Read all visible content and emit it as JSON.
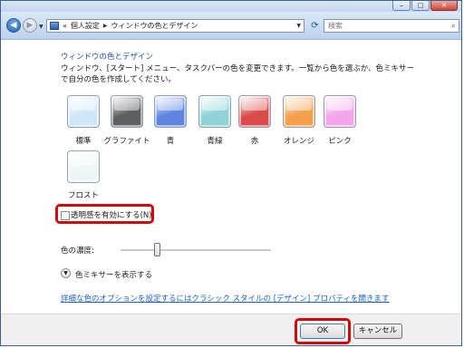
{
  "window": {
    "caption_buttons": {
      "minimize": "‒",
      "maximize": "□",
      "close": "✕"
    }
  },
  "navbar": {
    "breadcrumb_prefix": "«",
    "breadcrumb": [
      "個人設定",
      "ウィンドウの色とデザイン"
    ],
    "search_placeholder": "検索",
    "icons": [
      "back-arrow-icon",
      "forward-arrow-icon",
      "refresh-icon",
      "search-icon"
    ]
  },
  "main": {
    "heading": "ウィンドウの色とデザイン",
    "description": "ウィンドウ、[スタート] メニュー、タスクバーの色を変更できます。一覧から色を選ぶか、色ミキサーで自分の色を作成してください。",
    "swatches": [
      {
        "label": "標準",
        "color": "#cfe6f8"
      },
      {
        "label": "グラファイト",
        "color": "#5f5f5f"
      },
      {
        "label": "青",
        "color": "#5d84e0"
      },
      {
        "label": "青緑",
        "color": "#8fd3d6"
      },
      {
        "label": "赤",
        "color": "#db4a4a"
      },
      {
        "label": "オレンジ",
        "color": "#f5a04c"
      },
      {
        "label": "ピンク",
        "color": "#f3a6ea"
      },
      {
        "label": "フロスト",
        "color": "#eef5f5"
      }
    ],
    "transparency_label": "透明感を有効にする(N)",
    "transparency_checked": false,
    "intensity_label": "色の濃度:",
    "intensity_level": 0.24,
    "mixer_toggle": "色ミキサーを表示する",
    "advanced_link": "詳細な色のオプションを設定するにはクラシック スタイルの [デザイン] プロパティを開きます"
  },
  "footer": {
    "ok_label": "OK",
    "cancel_label": "キャンセル"
  },
  "highlight_color": "#d10a0a"
}
